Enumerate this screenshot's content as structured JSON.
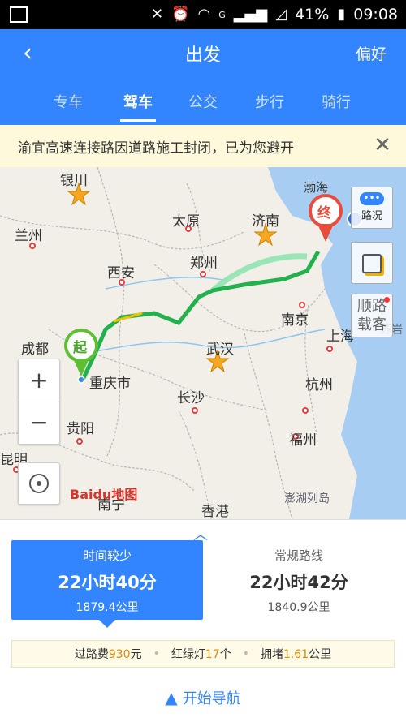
{
  "status": {
    "battery": "41%",
    "time": "09:08",
    "network": "G"
  },
  "header": {
    "back_icon": "back-arrow-icon",
    "title": "出发",
    "preference": "偏好"
  },
  "tabs": [
    {
      "label": "专车"
    },
    {
      "label": "驾车"
    },
    {
      "label": "公交"
    },
    {
      "label": "步行"
    },
    {
      "label": "骑行"
    }
  ],
  "notice": {
    "text": "渝宜高速连接路因道路施工封闭，已为您避开"
  },
  "map": {
    "cities": {
      "yinchuan": "银川",
      "lanzhou": "兰州",
      "taiyuan": "太原",
      "jinan": "济南",
      "bohai": "渤海",
      "xian": "西安",
      "zhengzhou": "郑州",
      "nanjing": "南京",
      "shanghai": "上海",
      "chengdu": "成都",
      "wuhan": "武汉",
      "chongqing": "重庆市",
      "changsha": "长沙",
      "hangzhou": "杭州",
      "guiyang": "贵阳",
      "fuzhou": "福州",
      "kunming": "昆明",
      "nanning": "南宁",
      "xianggang": "香港",
      "penghu": "澎湖列岛",
      "suyan": "苏岩"
    },
    "start_marker": "起",
    "end_marker": "终",
    "traffic_label": "路况",
    "ride_label": "顺路载客",
    "zoom_in": "+",
    "zoom_out": "−",
    "logo_text": "Baidu地图",
    "route_color": "#22b14c",
    "alt_route_color": "#8fe3b0"
  },
  "routes": [
    {
      "label": "时间较少",
      "duration": "22小时40分",
      "distance": "1879.4公里",
      "selected": true
    },
    {
      "label": "常规路线",
      "duration": "22小时42分",
      "distance": "1840.9公里",
      "selected": false
    }
  ],
  "stats": {
    "toll_prefix": "过路费",
    "toll_value": "930",
    "toll_unit": "元",
    "lights_prefix": "红绿灯",
    "lights_value": "17",
    "lights_unit": "个",
    "jam_prefix": "拥堵",
    "jam_value": "1.61",
    "jam_unit": "公里"
  },
  "nav": {
    "label": "开始导航"
  },
  "colors": {
    "brand": "#3385ff",
    "notice_bg": "#fff9db",
    "highlight": "#e08a00"
  }
}
